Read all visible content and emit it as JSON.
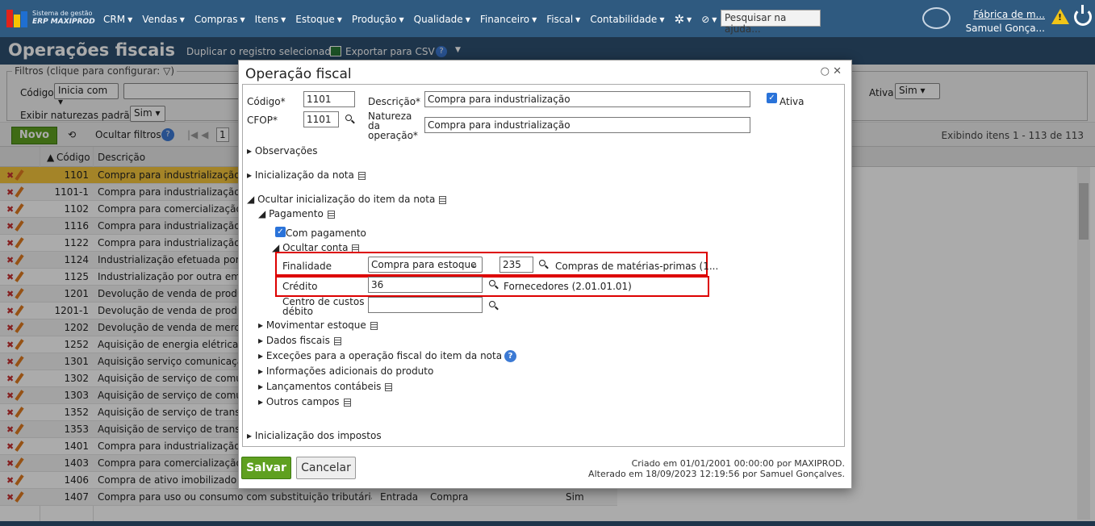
{
  "app": {
    "brand_line1": "Sistema de gestão",
    "brand_line2": "ERP MAXIPROD"
  },
  "menu": [
    "CRM",
    "Vendas",
    "Compras",
    "Itens",
    "Estoque",
    "Produção",
    "Qualidade",
    "Financeiro",
    "Fiscal",
    "Contabilidade"
  ],
  "help_search": {
    "placeholder": "Pesquisar na ajuda..."
  },
  "user": {
    "company": "Fábrica de m...",
    "name": "Samuel Gonça..."
  },
  "page": {
    "title": "Operações fiscais",
    "duplicate": "Duplicar o registro selecionado",
    "export": "Exportar para CSV"
  },
  "filters": {
    "legend": "Filtros (clique para configurar:",
    "codigo_label": "Código",
    "codigo_op": "Inicia com",
    "natureza_label": "Exibir naturezas padrão",
    "natureza_val": "Sim",
    "ativa_label": "Ativa",
    "ativa_val": "Sim"
  },
  "toolbar": {
    "novo": "Novo",
    "ocultar": "Ocultar filtros",
    "page": "1",
    "count": "Exibindo itens 1 - 113 de 113"
  },
  "grid": {
    "headers": {
      "codigo": "Código",
      "descricao": "Descrição"
    },
    "rows": [
      {
        "codigo": "1101",
        "descricao": "Compra para industrialização",
        "c3": "",
        "c4": "",
        "c5": ""
      },
      {
        "codigo": "1101-1",
        "descricao": "Compra para industrialização",
        "c3": "",
        "c4": "",
        "c5": ""
      },
      {
        "codigo": "1102",
        "descricao": "Compra para comercialização",
        "c3": "",
        "c4": "",
        "c5": ""
      },
      {
        "codigo": "1116",
        "descricao": "Compra para industrialização de",
        "c3": "",
        "c4": "",
        "c5": ""
      },
      {
        "codigo": "1122",
        "descricao": "Compra para industrialização re",
        "c3": "",
        "c4": "",
        "c5": ""
      },
      {
        "codigo": "1124",
        "descricao": "Industrialização efetuada por ou",
        "c3": "",
        "c4": "",
        "c5": ""
      },
      {
        "codigo": "1125",
        "descricao": "Industrialização por outra empre",
        "c3": "",
        "c4": "",
        "c5": ""
      },
      {
        "codigo": "1201",
        "descricao": "Devolução de venda de produçã",
        "c3": "",
        "c4": "",
        "c5": ""
      },
      {
        "codigo": "1201-1",
        "descricao": "Devolução de venda de produçã",
        "c3": "",
        "c4": "",
        "c5": ""
      },
      {
        "codigo": "1202",
        "descricao": "Devolução de venda de mercado",
        "c3": "",
        "c4": "",
        "c5": ""
      },
      {
        "codigo": "1252",
        "descricao": "Aquisição de energia elétrica",
        "c3": "",
        "c4": "",
        "c5": ""
      },
      {
        "codigo": "1301",
        "descricao": "Aquisição serviço comunicação p",
        "c3": "",
        "c4": "",
        "c5": ""
      },
      {
        "codigo": "1302",
        "descricao": "Aquisição de serviço de comunic",
        "c3": "",
        "c4": "",
        "c5": ""
      },
      {
        "codigo": "1303",
        "descricao": "Aquisição de serviço de comunic",
        "c3": "",
        "c4": "",
        "c5": ""
      },
      {
        "codigo": "1352",
        "descricao": "Aquisição de serviço de transpor",
        "c3": "",
        "c4": "",
        "c5": ""
      },
      {
        "codigo": "1353",
        "descricao": "Aquisição de serviço de transpor",
        "c3": "",
        "c4": "",
        "c5": ""
      },
      {
        "codigo": "1401",
        "descricao": "Compra para industrialização co",
        "c3": "",
        "c4": "",
        "c5": ""
      },
      {
        "codigo": "1403",
        "descricao": "Compra para comercialização co",
        "c3": "",
        "c4": "",
        "c5": ""
      },
      {
        "codigo": "1406",
        "descricao": "Compra de ativo imobilizado cor",
        "c3": "",
        "c4": "",
        "c5": ""
      },
      {
        "codigo": "1407",
        "descricao": "Compra para uso ou consumo com substituição tributária",
        "c3": "Entrada",
        "c4": "Compra",
        "c5": "Sim"
      }
    ]
  },
  "dialog": {
    "title": "Operação fiscal",
    "codigo_label": "Código*",
    "codigo": "1101",
    "cfop_label": "CFOP*",
    "cfop": "1101",
    "descricao_label": "Descrição*",
    "descricao": "Compra para industrialização",
    "natureza_label_1": "Natureza",
    "natureza_label_2": "da",
    "natureza_label_3": "operação*",
    "natureza": "Compra para industrialização",
    "ativa_label": "Ativa",
    "sections": {
      "observacoes": "Observações",
      "inicializacao_nota": "Inicialização da nota",
      "ocultar_item": "Ocultar inicialização do item da nota",
      "pagamento": "Pagamento",
      "com_pagamento": "Com pagamento",
      "ocultar_conta": "Ocultar conta",
      "movimentar_estoque": "Movimentar estoque",
      "dados_fiscais": "Dados fiscais",
      "excecoes": "Exceções para a operação fiscal do item da nota",
      "info_adicionais": "Informações adicionais do produto",
      "lancamentos": "Lançamentos contábeis",
      "outros": "Outros campos",
      "impostos": "Inicialização dos impostos"
    },
    "finalidade_label": "Finalidade",
    "finalidade": "Compra para estoque",
    "finalidade_code": "235",
    "finalidade_desc": "Compras de matérias-primas (1...",
    "credito_label": "Crédito",
    "credito": "36",
    "credito_desc": "Fornecedores (2.01.01.01)",
    "centro_label_1": "Centro de custos",
    "centro_label_2": "débito",
    "salvar": "Salvar",
    "cancelar": "Cancelar",
    "criado": "Criado em 01/01/2001 00:00:00 por MAXIPROD.",
    "alterado": "Alterado em 18/09/2023 12:19:56 por Samuel Gonçalves."
  }
}
